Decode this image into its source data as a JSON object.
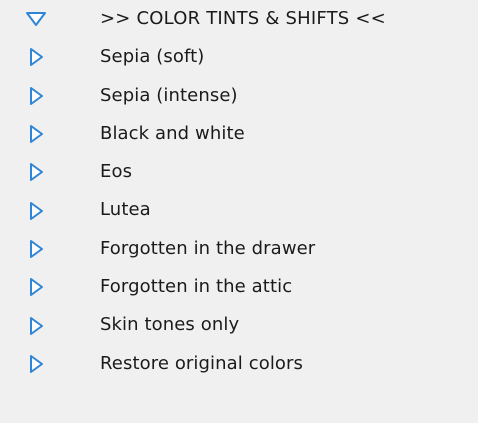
{
  "tree": {
    "header": {
      "label": ">> COLOR TINTS & SHIFTS <<",
      "icon": "triangle-down-icon",
      "expanded": true
    },
    "items": [
      {
        "label": "Sepia (soft)",
        "icon": "triangle-right-icon"
      },
      {
        "label": "Sepia (intense)",
        "icon": "triangle-right-icon"
      },
      {
        "label": "Black and white",
        "icon": "triangle-right-icon"
      },
      {
        "label": "Eos",
        "icon": "triangle-right-icon"
      },
      {
        "label": "Lutea",
        "icon": "triangle-right-icon"
      },
      {
        "label": "Forgotten in the drawer",
        "icon": "triangle-right-icon"
      },
      {
        "label": "Forgotten in the attic",
        "icon": "triangle-right-icon"
      },
      {
        "label": "Skin tones only",
        "icon": "triangle-right-icon"
      },
      {
        "label": "Restore original colors",
        "icon": "triangle-right-icon"
      }
    ]
  },
  "colors": {
    "background": "#f0f0f0",
    "text": "#1a1a1a",
    "triangle_stroke": "#2f86d6",
    "triangle_fill": "#ffffff"
  }
}
